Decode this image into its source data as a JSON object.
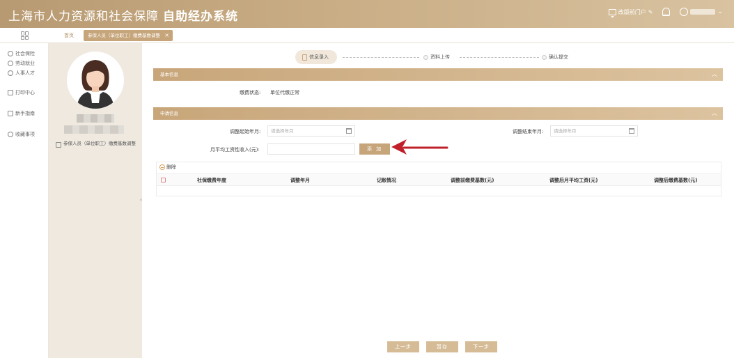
{
  "header": {
    "title": "上海市人力资源和社会保障",
    "subtitle": "自助经办系统",
    "portal_link": "改版前门户",
    "colors": {
      "header_gold": "#c9ad85",
      "accent": "#c6a57a",
      "arrow_red": "#c0202a"
    }
  },
  "tabs": {
    "home": "首页",
    "active": "参保人员（单位职工）缴费基数调整",
    "close": "×"
  },
  "nav": {
    "items": [
      {
        "label": "社会保险",
        "icon": "shield-icon"
      },
      {
        "label": "劳动就业",
        "icon": "person-icon"
      },
      {
        "label": "人事人才",
        "icon": "people-icon"
      },
      {
        "label": "打印中心",
        "icon": "printer-icon"
      },
      {
        "label": "新手指南",
        "icon": "guide-icon"
      },
      {
        "label": "收藏事项",
        "icon": "star-icon"
      }
    ]
  },
  "profile": {
    "link": "参保人员（单位职工）缴费基数调整"
  },
  "steps": [
    {
      "label": "信息录入",
      "state": "active"
    },
    {
      "label": "资料上传",
      "state": "pending"
    },
    {
      "label": "确认提交",
      "state": "pending"
    }
  ],
  "basic": {
    "section_title": "基本信息",
    "status_label": "缴费状态:",
    "status_value": "单位代缴正常"
  },
  "apply": {
    "section_title": "申请信息",
    "start_label": "调整起始年月:",
    "start_placeholder": "请选择年月",
    "end_label": "调整结束年月:",
    "end_placeholder": "请选择年月",
    "income_label": "月平均工资性收入(元):",
    "income_value": "",
    "add_button": "添 加"
  },
  "table": {
    "delete_label": "删除",
    "columns": [
      "社保缴费年度",
      "调整年月",
      "记账情况",
      "调整前缴费基数(元)",
      "调整后月平均工资(元)",
      "调整后缴费基数(元)"
    ]
  },
  "footer": {
    "prev": "上一步",
    "save": "暂存",
    "next": "下一步"
  }
}
